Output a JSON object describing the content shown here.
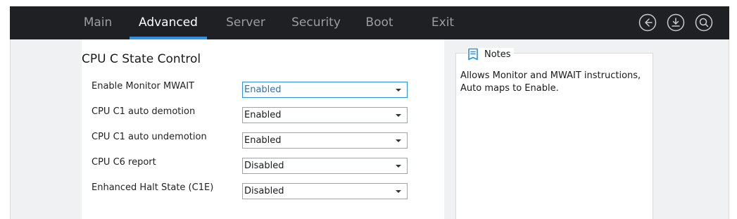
{
  "nav": {
    "tabs": [
      {
        "label": "Main"
      },
      {
        "label": "Advanced",
        "active": true
      },
      {
        "label": "Server"
      },
      {
        "label": "Security"
      },
      {
        "label": "Boot"
      },
      {
        "label": "Exit"
      }
    ],
    "icons": [
      "back-icon",
      "save-download-icon",
      "search-icon"
    ],
    "accent_color": "#2f8fe0",
    "bar_color": "#1e2023"
  },
  "section": {
    "title": "CPU C State Control",
    "settings": [
      {
        "label": "Enable Monitor MWAIT",
        "value": "Enabled",
        "focused": true
      },
      {
        "label": "CPU C1 auto demotion",
        "value": "Enabled"
      },
      {
        "label": "CPU C1 auto undemotion",
        "value": "Enabled"
      },
      {
        "label": "CPU C6 report",
        "value": "Disabled"
      },
      {
        "label": "Enhanced Halt State (C1E)",
        "value": "Disabled"
      }
    ]
  },
  "notes": {
    "title": "Notes",
    "icon": "notes-icon",
    "text": "Allows Monitor and MWAIT instructions, Auto maps to Enable."
  }
}
